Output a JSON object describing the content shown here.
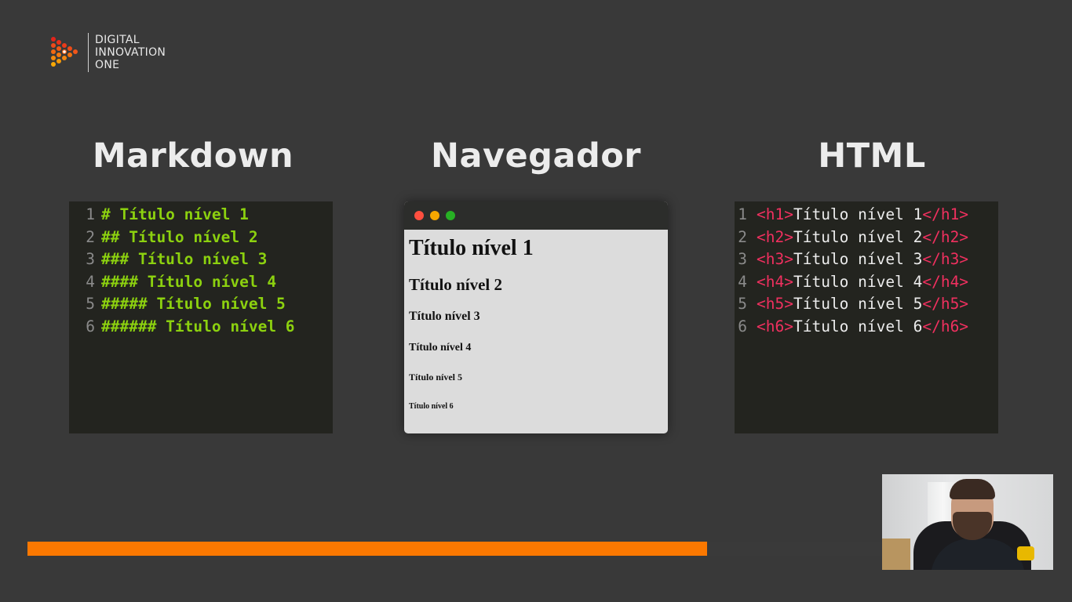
{
  "brand": {
    "lines": [
      "DIGITAL",
      "INNOVATION",
      "ONE"
    ],
    "accent_color": "#fb7800"
  },
  "sections": {
    "markdown": {
      "title": "Markdown"
    },
    "browser": {
      "title": "Navegador"
    },
    "html": {
      "title": "HTML"
    }
  },
  "markdown_code": {
    "lines": [
      {
        "num": "1",
        "text": "# Título nível 1"
      },
      {
        "num": "2",
        "text": "## Título nível 2"
      },
      {
        "num": "3",
        "text": "### Título nível 3"
      },
      {
        "num": "4",
        "text": "#### Título nível 4"
      },
      {
        "num": "5",
        "text": "##### Título nível 5"
      },
      {
        "num": "6",
        "text": "###### Título nível 6"
      }
    ],
    "text_color": "#8cd10f"
  },
  "browser_preview": {
    "window_buttons": [
      {
        "name": "close",
        "color": "#ff4f3f"
      },
      {
        "name": "minimize",
        "color": "#f5a700"
      },
      {
        "name": "maximize",
        "color": "#27b024"
      }
    ],
    "headings": [
      "Título nível 1",
      "Título nível 2",
      "Título nível 3",
      "Título nível 4",
      "Título nível 5",
      "Título nível 6"
    ]
  },
  "html_code": {
    "lines": [
      {
        "num": "1",
        "open": "<h1>",
        "text": "Título nível 1",
        "close": "</h1>"
      },
      {
        "num": "2",
        "open": "<h2>",
        "text": "Título nível 2",
        "close": "</h2>"
      },
      {
        "num": "3",
        "open": "<h3>",
        "text": "Título nível 3",
        "close": "</h3>"
      },
      {
        "num": "4",
        "open": "<h4>",
        "text": "Título nível 4",
        "close": "</h4>"
      },
      {
        "num": "5",
        "open": "<h5>",
        "text": "Título nível 5",
        "close": "</h5>"
      },
      {
        "num": "6",
        "open": "<h6>",
        "text": "Título nível 6",
        "close": "</h6>"
      }
    ],
    "tag_color": "#f0305f"
  },
  "video": {
    "progress": 0.795
  },
  "webcam": {
    "icon": "presenter-webcam"
  }
}
